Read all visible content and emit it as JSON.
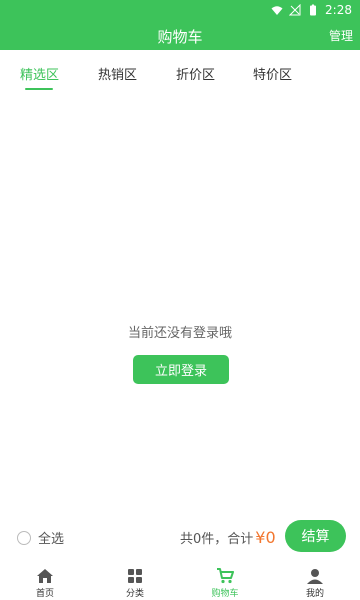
{
  "status_bar": {
    "time": "2:28"
  },
  "header": {
    "title": "购物车",
    "manage": "管理"
  },
  "tabs": [
    {
      "label": "精选区",
      "active": true
    },
    {
      "label": "热销区",
      "active": false
    },
    {
      "label": "折价区",
      "active": false
    },
    {
      "label": "特价区",
      "active": false
    }
  ],
  "empty_state": {
    "message": "当前还没有登录哦",
    "login_button": "立即登录"
  },
  "checkout": {
    "select_all": "全选",
    "summary": "共0件，合计",
    "price": "¥0",
    "pay_button": "结算"
  },
  "bottom_nav": [
    {
      "label": "首页",
      "icon": "home-icon"
    },
    {
      "label": "分类",
      "icon": "category-icon"
    },
    {
      "label": "购物车",
      "icon": "cart-icon",
      "active": true
    },
    {
      "label": "我的",
      "icon": "user-icon"
    }
  ],
  "colors": {
    "accent": "#3dc35a",
    "price": "#f2762e"
  }
}
